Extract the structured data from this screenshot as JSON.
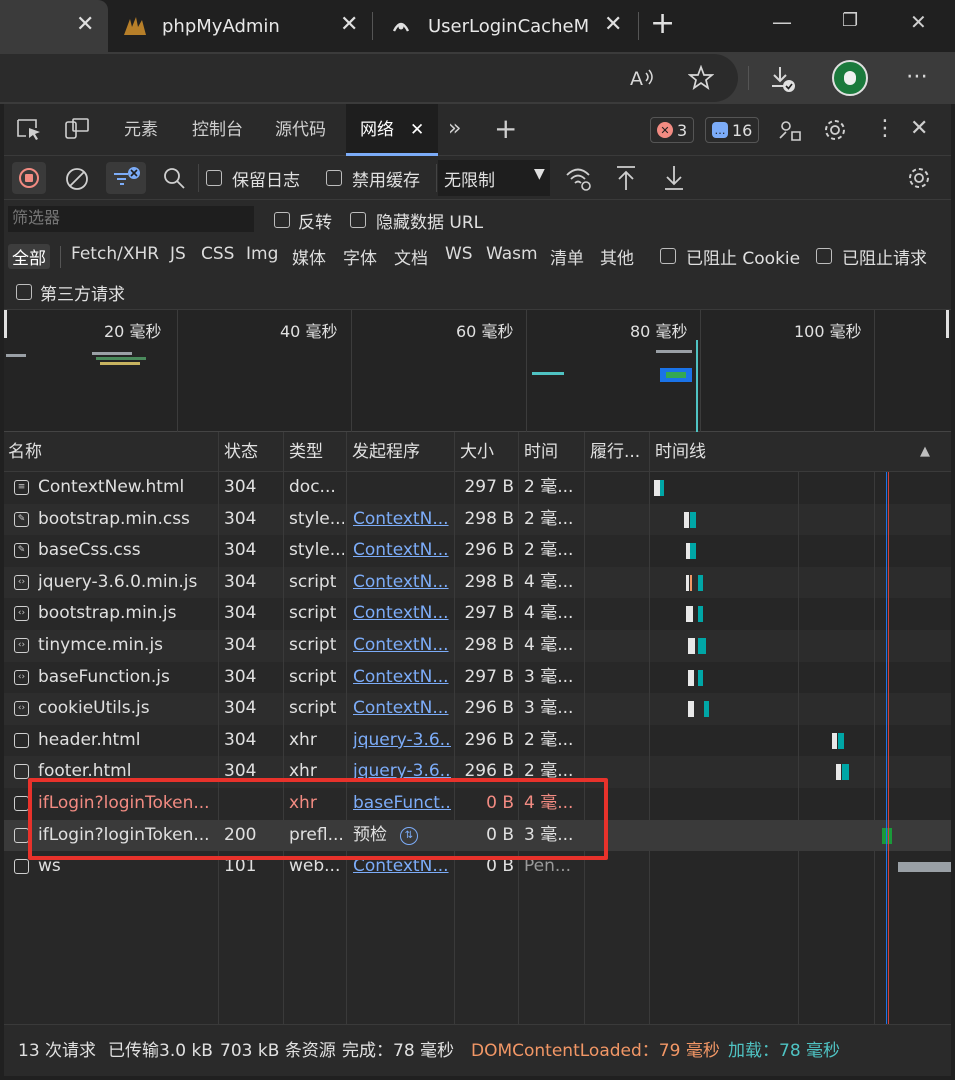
{
  "browser": {
    "tabs": [
      {
        "label": ""
      },
      {
        "label": "phpMyAdmin"
      },
      {
        "label": "UserLoginCacheMap"
      }
    ],
    "new_tab": "+"
  },
  "devtools": {
    "tabs": [
      "元素",
      "控制台",
      "源代码",
      "网络"
    ],
    "errors_count": "3",
    "messages_count": "16",
    "toolbar": {
      "preserve_log": "保留日志",
      "disable_cache": "禁用缓存",
      "throttle": "无限制"
    },
    "filter": {
      "placeholder": "筛选器",
      "invert": "反转",
      "hide_data_url": "隐藏数据 URL",
      "types": [
        "全部",
        "Fetch/XHR",
        "JS",
        "CSS",
        "Img",
        "媒体",
        "字体",
        "文档",
        "WS",
        "Wasm",
        "清单",
        "其他"
      ],
      "blocked_cookies": "已阻止 Cookie",
      "blocked_requests": "已阻止请求",
      "third_party": "第三方请求"
    },
    "overview_ticks": [
      "20 毫秒",
      "40 毫秒",
      "60 毫秒",
      "80 毫秒",
      "100 毫秒"
    ],
    "columns": [
      "名称",
      "状态",
      "类型",
      "发起程序",
      "大小",
      "时间",
      "履行...",
      "时间线"
    ],
    "rows": [
      {
        "name": "ContextNew.html",
        "status": "304",
        "type": "doc...",
        "initiator": "",
        "size": "297 B",
        "time": "2 毫...",
        "icon": "document-icon"
      },
      {
        "name": "bootstrap.min.css",
        "status": "304",
        "type": "style...",
        "initiator": "ContextN...",
        "size": "298 B",
        "time": "2 毫...",
        "icon": "stylesheet-icon"
      },
      {
        "name": "baseCss.css",
        "status": "304",
        "type": "style...",
        "initiator": "ContextN...",
        "size": "296 B",
        "time": "2 毫...",
        "icon": "stylesheet-icon"
      },
      {
        "name": "jquery-3.6.0.min.js",
        "status": "304",
        "type": "script",
        "initiator": "ContextN...",
        "size": "298 B",
        "time": "4 毫...",
        "icon": "script-icon"
      },
      {
        "name": "bootstrap.min.js",
        "status": "304",
        "type": "script",
        "initiator": "ContextN...",
        "size": "297 B",
        "time": "4 毫...",
        "icon": "script-icon"
      },
      {
        "name": "tinymce.min.js",
        "status": "304",
        "type": "script",
        "initiator": "ContextN...",
        "size": "298 B",
        "time": "4 毫...",
        "icon": "script-icon"
      },
      {
        "name": "baseFunction.js",
        "status": "304",
        "type": "script",
        "initiator": "ContextN...",
        "size": "297 B",
        "time": "3 毫...",
        "icon": "script-icon"
      },
      {
        "name": "cookieUtils.js",
        "status": "304",
        "type": "script",
        "initiator": "ContextN...",
        "size": "296 B",
        "time": "3 毫...",
        "icon": "script-icon"
      },
      {
        "name": "header.html",
        "status": "304",
        "type": "xhr",
        "initiator": "jquery-3.6...",
        "size": "296 B",
        "time": "2 毫...",
        "icon": "xhr-icon"
      },
      {
        "name": "footer.html",
        "status": "304",
        "type": "xhr",
        "initiator": "jquery-3.6...",
        "size": "296 B",
        "time": "2 毫...",
        "icon": "xhr-icon"
      },
      {
        "name": "ifLogin?loginToken...",
        "status": "",
        "type": "xhr",
        "initiator": "baseFunct...",
        "size": "0 B",
        "time": "4 毫...",
        "icon": "xhr-icon",
        "error": true
      },
      {
        "name": "ifLogin?loginToken...",
        "status": "200",
        "type": "prefl...",
        "initiator": "预检",
        "size": "0 B",
        "time": "3 毫...",
        "icon": "xhr-icon",
        "selected": true
      },
      {
        "name": "ws",
        "status": "101",
        "type": "web...",
        "initiator": "ContextN...",
        "size": "0 B",
        "time": "Pen...",
        "icon": "websocket-icon"
      }
    ],
    "status_bar": {
      "requests": "13 次请求",
      "transferred": "已传输3.0 kB",
      "resources": "703 kB 条资源",
      "finish": "完成：78 毫秒",
      "dcl": "DOMContentLoaded：79 毫秒",
      "load": "加载：78 毫秒"
    },
    "colors": {
      "accent": "#7cacf8",
      "error": "#f28b82",
      "dcl": "#f29766",
      "load": "#4fc3c3",
      "highlight": "#e8322b"
    }
  }
}
